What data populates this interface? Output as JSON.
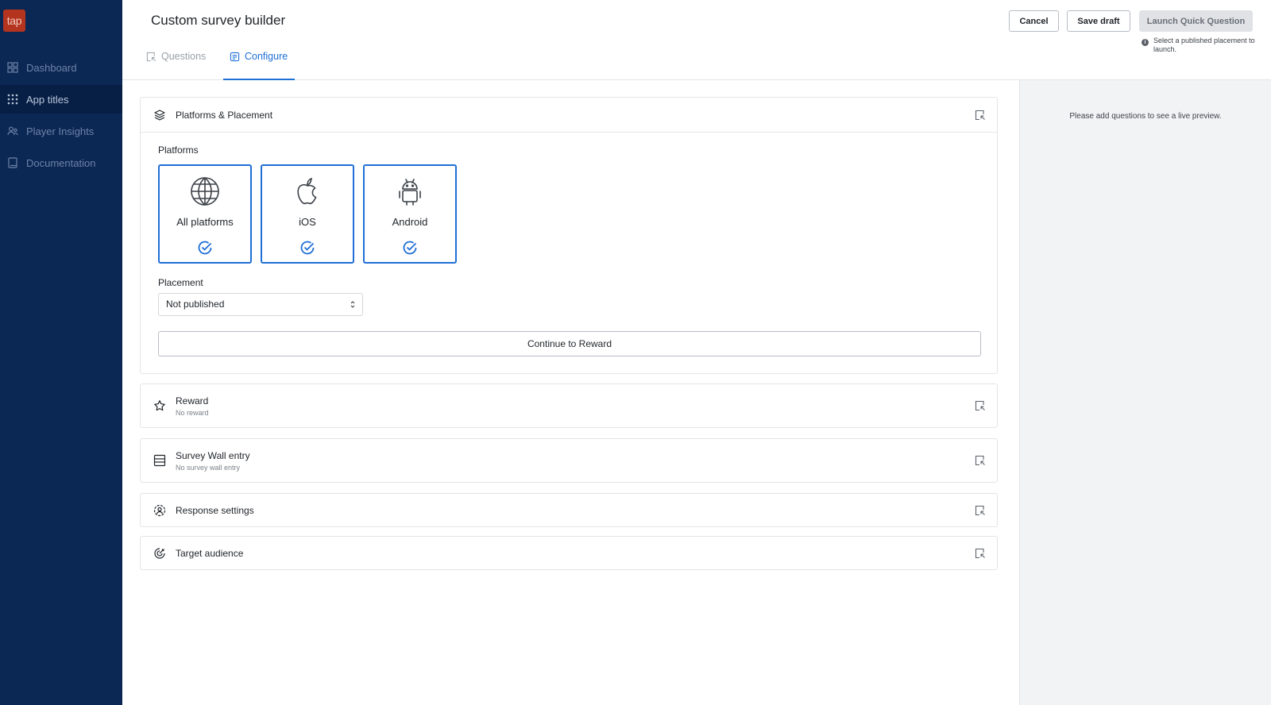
{
  "sidebar": {
    "logo": "tap",
    "items": [
      {
        "label": "Dashboard",
        "icon": "grid-icon"
      },
      {
        "label": "App titles",
        "icon": "apps-icon",
        "active": true
      },
      {
        "label": "Player Insights",
        "icon": "users-icon"
      },
      {
        "label": "Documentation",
        "icon": "book-icon"
      }
    ]
  },
  "header": {
    "title": "Custom survey builder",
    "cancel_label": "Cancel",
    "save_draft_label": "Save draft",
    "launch_label": "Launch Quick Question",
    "launch_hint": "Select a published placement to launch."
  },
  "tabs": [
    {
      "label": "Questions",
      "active": false
    },
    {
      "label": "Configure",
      "active": true
    }
  ],
  "preview": {
    "text": "Please add questions to see a live preview."
  },
  "platforms_section": {
    "title": "Platforms & Placement",
    "platforms_label": "Platforms",
    "platforms": [
      {
        "label": "All platforms",
        "icon": "globe-icon",
        "selected": true
      },
      {
        "label": "iOS",
        "icon": "apple-icon",
        "selected": true
      },
      {
        "label": "Android",
        "icon": "android-icon",
        "selected": true
      }
    ],
    "placement_label": "Placement",
    "placement_value": "Not published",
    "continue_label": "Continue to Reward"
  },
  "sections": [
    {
      "title": "Reward",
      "subtitle": "No reward",
      "icon": "star-icon"
    },
    {
      "title": "Survey Wall entry",
      "subtitle": "No survey wall entry",
      "icon": "list-icon"
    },
    {
      "title": "Response settings",
      "subtitle": "",
      "icon": "user-circle-icon"
    },
    {
      "title": "Target audience",
      "subtitle": "",
      "icon": "target-icon"
    }
  ],
  "colors": {
    "sidebar_bg": "#0b2754",
    "accent": "#1f6fd6",
    "logo_bg": "#b5341f"
  }
}
